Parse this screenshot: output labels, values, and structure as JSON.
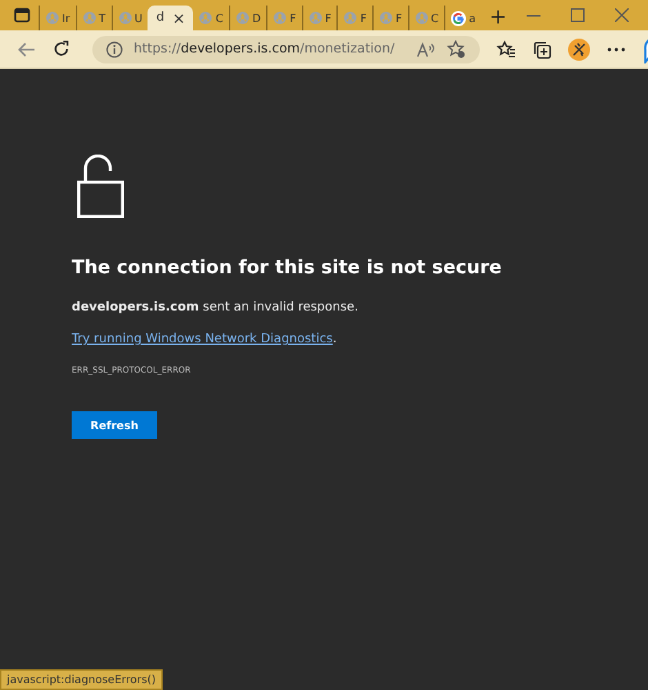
{
  "tabs": [
    {
      "label": "Ir",
      "kind": "site",
      "selected": false
    },
    {
      "label": "T",
      "kind": "site",
      "selected": false
    },
    {
      "label": "U",
      "kind": "site",
      "selected": false
    },
    {
      "label": "d",
      "kind": "plain",
      "selected": true
    },
    {
      "label": "C",
      "kind": "site",
      "selected": false
    },
    {
      "label": "D",
      "kind": "site",
      "selected": false
    },
    {
      "label": "F",
      "kind": "site",
      "selected": false
    },
    {
      "label": "F",
      "kind": "site",
      "selected": false
    },
    {
      "label": "F",
      "kind": "site",
      "selected": false
    },
    {
      "label": "F",
      "kind": "site",
      "selected": false
    },
    {
      "label": "C",
      "kind": "site",
      "selected": false
    },
    {
      "label": "a",
      "kind": "google",
      "selected": false
    }
  ],
  "close_tab": "×",
  "new_tab": "+",
  "address": {
    "scheme": "https://",
    "host": "developers.is.com",
    "path": "/monetization/"
  },
  "error": {
    "title": "The connection for this site is not secure",
    "message": "**developers.is.com** sent an invalid response.",
    "link": "Try running Windows Network Diagnostics",
    "link_after": ".",
    "code": "ERR_SSL_PROTOCOL_ERROR",
    "button": "Refresh"
  },
  "status_bar": "javascript:diagnoseErrors()"
}
